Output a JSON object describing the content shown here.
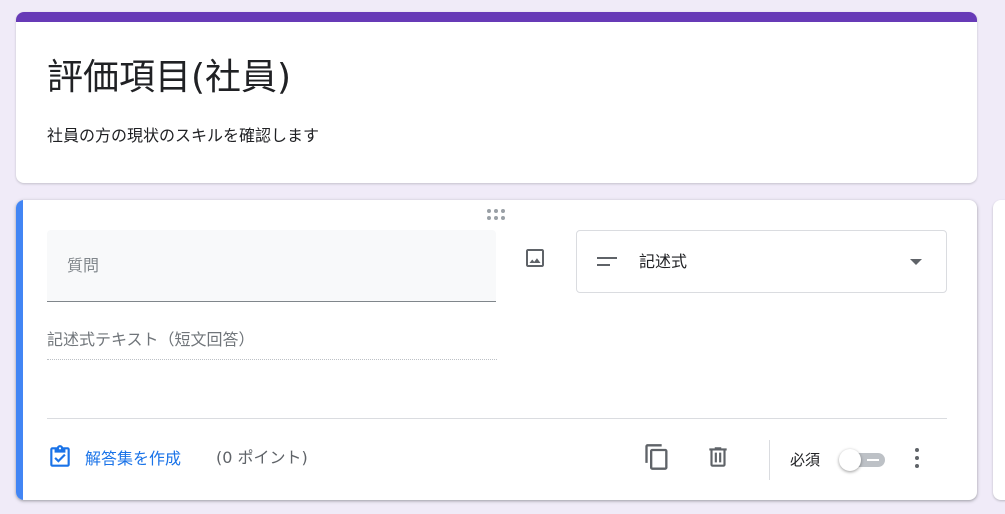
{
  "form": {
    "title": "評価項目(社員)",
    "description": "社員の方の現状のスキルを確認します",
    "theme_color": "#673ab7",
    "background_color": "#f0ebf8"
  },
  "question": {
    "accent_color": "#4285f4",
    "title_placeholder": "質問",
    "type_icon": "short-answer-icon",
    "type_label": "記述式",
    "answer_hint": "記述式テキスト（短文回答）",
    "answer_key_label": "解答集を作成",
    "points_label": "(0 ポイント)",
    "required_label": "必須",
    "required": false,
    "icons": {
      "drag": "drag-handle-icon",
      "image": "image-icon",
      "dropdown": "dropdown-arrow-icon",
      "answer_key": "checkbox-clipboard-icon",
      "duplicate": "copy-icon",
      "delete": "trash-icon",
      "more": "more-vert-icon"
    }
  }
}
